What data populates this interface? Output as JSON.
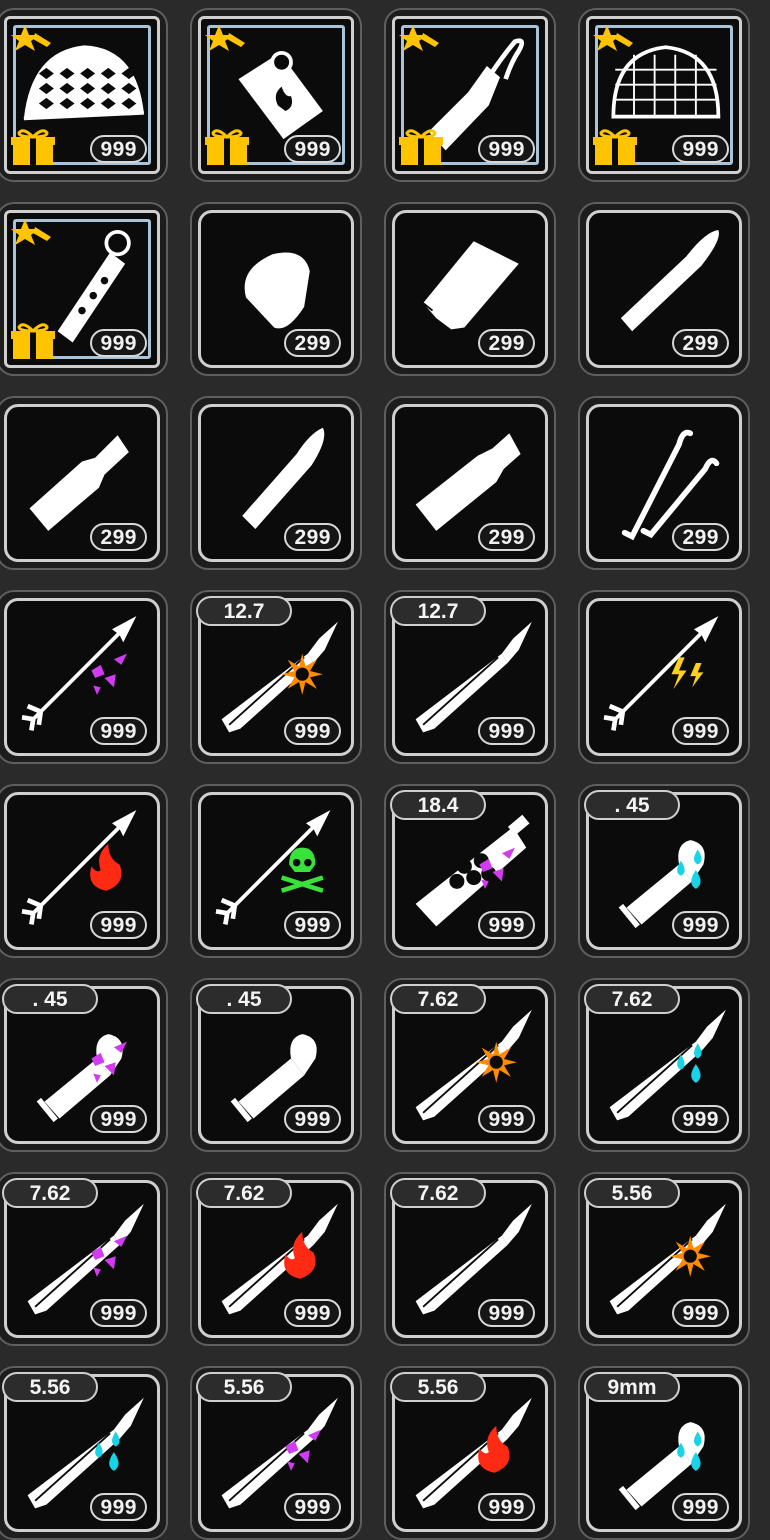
{
  "inventory": {
    "slots": [
      {
        "id": "r1c1",
        "item": "turtle-shell-net",
        "count": "999",
        "caliber": "",
        "effect": "",
        "featured": true
      },
      {
        "id": "r1c2",
        "item": "fire-canister",
        "count": "999",
        "caliber": "",
        "effect": "",
        "featured": true
      },
      {
        "id": "r1c3",
        "item": "molotov",
        "count": "999",
        "caliber": "",
        "effect": "",
        "featured": true
      },
      {
        "id": "r1c4",
        "item": "net-dome-trap",
        "count": "999",
        "caliber": "",
        "effect": "",
        "featured": true
      },
      {
        "id": "r2c1",
        "item": "smoke-grenade",
        "count": "999",
        "caliber": "",
        "effect": "",
        "featured": true
      },
      {
        "id": "r2c2",
        "item": "round-bullet",
        "count": "299",
        "caliber": "",
        "effect": "",
        "featured": false
      },
      {
        "id": "r2c3",
        "item": "wide-cartridge",
        "count": "299",
        "caliber": "",
        "effect": "",
        "featured": false
      },
      {
        "id": "r2c4",
        "item": "pointed-bullet",
        "count": "299",
        "caliber": "",
        "effect": "",
        "featured": false
      },
      {
        "id": "r3c1",
        "item": "bottleneck-cartridge",
        "count": "299",
        "caliber": "",
        "effect": "",
        "featured": false
      },
      {
        "id": "r3c2",
        "item": "slim-bullet",
        "count": "299",
        "caliber": "",
        "effect": "",
        "featured": false
      },
      {
        "id": "r3c3",
        "item": "large-cartridge",
        "count": "299",
        "caliber": "",
        "effect": "",
        "featured": false
      },
      {
        "id": "r3c4",
        "item": "lockpicks",
        "count": "299",
        "caliber": "",
        "effect": "",
        "featured": false
      },
      {
        "id": "r4c1",
        "item": "arrow",
        "count": "999",
        "caliber": "",
        "effect": "shatter",
        "featured": false
      },
      {
        "id": "r4c2",
        "item": "rifle-round",
        "count": "999",
        "caliber": "12.7",
        "effect": "explosive",
        "featured": false
      },
      {
        "id": "r4c3",
        "item": "rifle-round",
        "count": "999",
        "caliber": "12.7",
        "effect": "",
        "featured": false
      },
      {
        "id": "r4c4",
        "item": "arrow",
        "count": "999",
        "caliber": "",
        "effect": "electric",
        "featured": false
      },
      {
        "id": "r5c1",
        "item": "arrow",
        "count": "999",
        "caliber": "",
        "effect": "fire",
        "featured": false
      },
      {
        "id": "r5c2",
        "item": "arrow",
        "count": "999",
        "caliber": "",
        "effect": "poison",
        "featured": false
      },
      {
        "id": "r5c3",
        "item": "shotgun-shell",
        "count": "999",
        "caliber": "18.4",
        "effect": "shatter",
        "featured": false
      },
      {
        "id": "r5c4",
        "item": "pistol-round",
        "count": "999",
        "caliber": ". 45",
        "effect": "water",
        "featured": false
      },
      {
        "id": "r6c1",
        "item": "pistol-round",
        "count": "999",
        "caliber": ". 45",
        "effect": "shatter",
        "featured": false
      },
      {
        "id": "r6c2",
        "item": "pistol-round",
        "count": "999",
        "caliber": ". 45",
        "effect": "",
        "featured": false
      },
      {
        "id": "r6c3",
        "item": "rifle-round",
        "count": "999",
        "caliber": "7.62",
        "effect": "explosive",
        "featured": false
      },
      {
        "id": "r6c4",
        "item": "rifle-round",
        "count": "999",
        "caliber": "7.62",
        "effect": "water",
        "featured": false
      },
      {
        "id": "r7c1",
        "item": "rifle-round",
        "count": "999",
        "caliber": "7.62",
        "effect": "shatter",
        "featured": false
      },
      {
        "id": "r7c2",
        "item": "rifle-round",
        "count": "999",
        "caliber": "7.62",
        "effect": "fire",
        "featured": false
      },
      {
        "id": "r7c3",
        "item": "rifle-round",
        "count": "999",
        "caliber": "7.62",
        "effect": "",
        "featured": false
      },
      {
        "id": "r7c4",
        "item": "rifle-round",
        "count": "999",
        "caliber": "5.56",
        "effect": "explosive",
        "featured": false
      },
      {
        "id": "r8c1",
        "item": "rifle-round",
        "count": "999",
        "caliber": "5.56",
        "effect": "water",
        "featured": false
      },
      {
        "id": "r8c2",
        "item": "rifle-round",
        "count": "999",
        "caliber": "5.56",
        "effect": "shatter",
        "featured": false
      },
      {
        "id": "r8c3",
        "item": "rifle-round",
        "count": "999",
        "caliber": "5.56",
        "effect": "fire",
        "featured": false
      },
      {
        "id": "r8c4",
        "item": "pistol-round",
        "count": "999",
        "caliber": "9mm",
        "effect": "water",
        "featured": false
      }
    ]
  },
  "colors": {
    "background": "#2a2a2a",
    "slot_fill": "#0b0b0b",
    "icon": "#ffffff",
    "explosive": "#ff8c00",
    "water": "#19d3e6",
    "shatter": "#d13cf0",
    "electric": "#ffd21a",
    "fire": "#ff2a14",
    "poison": "#39e23a",
    "featured_frame": "#a9c4d8",
    "gift": "#ffc400"
  }
}
